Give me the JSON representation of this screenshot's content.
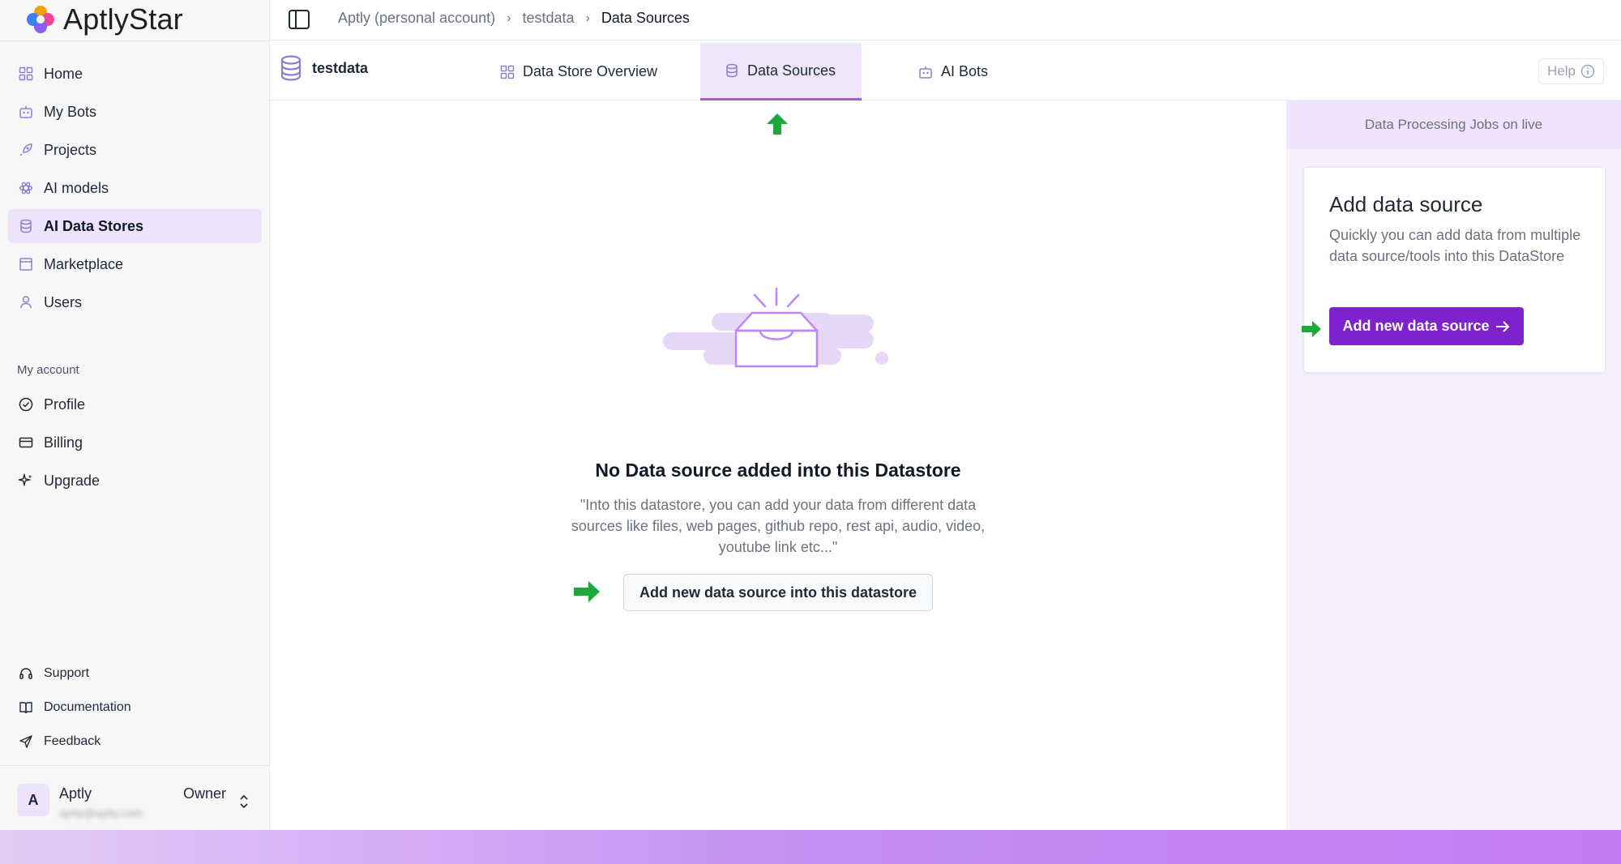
{
  "app": {
    "name": "AptlyStar"
  },
  "sidebar": {
    "items": [
      {
        "label": "Home",
        "icon": "home-icon"
      },
      {
        "label": "My Bots",
        "icon": "bot-icon"
      },
      {
        "label": "Projects",
        "icon": "rocket-icon"
      },
      {
        "label": "AI models",
        "icon": "atom-icon"
      },
      {
        "label": "AI Data Stores",
        "icon": "database-icon",
        "active": true
      },
      {
        "label": "Marketplace",
        "icon": "store-icon"
      },
      {
        "label": "Users",
        "icon": "user-icon"
      }
    ],
    "section_label": "My account",
    "account_items": [
      {
        "label": "Profile",
        "icon": "check-circle-icon"
      },
      {
        "label": "Billing",
        "icon": "credit-card-icon"
      },
      {
        "label": "Upgrade",
        "icon": "sparkles-icon"
      }
    ],
    "footer_items": [
      {
        "label": "Support",
        "icon": "headset-icon"
      },
      {
        "label": "Documentation",
        "icon": "book-icon"
      },
      {
        "label": "Feedback",
        "icon": "send-icon"
      }
    ],
    "user": {
      "initial": "A",
      "name": "Aptly",
      "email": "aptly@aptly.com",
      "role": "Owner"
    }
  },
  "breadcrumb": {
    "items": [
      "Aptly (personal account)",
      "testdata",
      "Data Sources"
    ]
  },
  "datastore": {
    "name": "testdata"
  },
  "tabs": [
    {
      "label": "Data Store Overview",
      "icon": "grid-icon"
    },
    {
      "label": "Data Sources",
      "icon": "database-icon",
      "active": true
    },
    {
      "label": "AI Bots",
      "icon": "bot-icon"
    }
  ],
  "help": {
    "label": "Help"
  },
  "empty_state": {
    "title": "No Data source added into this Datastore",
    "description": "\"Into this datastore, you can add your data from different data sources like files, web pages, github repo, rest api, audio, video, youtube link etc...\"",
    "button_label": "Add new data source into this datastore"
  },
  "right_panel": {
    "header": "Data Processing Jobs on live",
    "card_title": "Add data source",
    "card_description": "Quickly you can add data from multiple data source/tools into this DataStore",
    "button_label": "Add new data source"
  },
  "colors": {
    "accent": "#7e22ce",
    "active_bg": "#ede4fb",
    "annotation_arrow": "#1fa83a"
  }
}
